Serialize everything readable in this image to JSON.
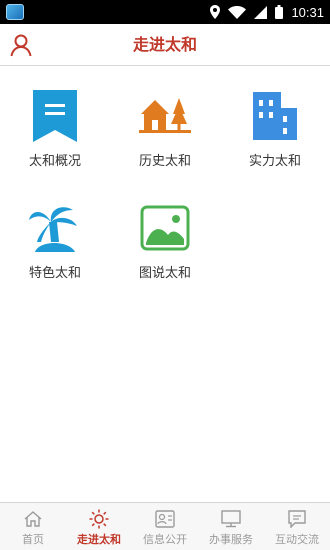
{
  "status_bar": {
    "time": "10:31",
    "icons": [
      "app-badge-icon",
      "location-icon",
      "wifi-icon",
      "signal-icon",
      "battery-icon"
    ]
  },
  "header": {
    "title": "走进太和",
    "user_icon": "user-icon"
  },
  "tiles": [
    {
      "label": "太和概况",
      "icon": "bookmark-icon",
      "color": "#1e9ad6"
    },
    {
      "label": "历史太和",
      "icon": "house-icon",
      "color": "#e07b20"
    },
    {
      "label": "实力太和",
      "icon": "building-icon",
      "color": "#3c8fe0"
    },
    {
      "label": "特色太和",
      "icon": "palm-island-icon",
      "color": "#1e9ad6"
    },
    {
      "label": "图说太和",
      "icon": "image-icon",
      "color": "#4cb050"
    }
  ],
  "colors": {
    "accent": "#c0392b",
    "nav_inactive": "#9a9a9a"
  },
  "bottom_nav": [
    {
      "label": "首页",
      "icon": "home-icon",
      "active": false
    },
    {
      "label": "走进太和",
      "icon": "sun-icon",
      "active": true
    },
    {
      "label": "信息公开",
      "icon": "id-card-icon",
      "active": false
    },
    {
      "label": "办事服务",
      "icon": "monitor-icon",
      "active": false
    },
    {
      "label": "互动交流",
      "icon": "chat-icon",
      "active": false
    }
  ]
}
